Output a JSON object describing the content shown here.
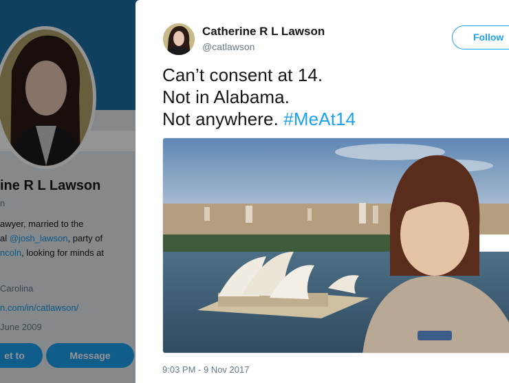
{
  "profile_background": {
    "name_fragment": "ine R L Lawson",
    "handle_fragment": "n",
    "bio_lines": [
      {
        "pre": "awyer, married to the",
        "link": ""
      },
      {
        "pre": "al ",
        "link": "@josh_lawson",
        "post": ", party of"
      },
      {
        "pre": "",
        "link": "ncoln",
        "post": ", looking for minds at"
      }
    ],
    "location_fragment": "Carolina",
    "url_fragment": "n.com/in/catlawson/",
    "joined_fragment": "June 2009",
    "follow_button_fragment": "et to",
    "message_button": "Message"
  },
  "tweet": {
    "author_name": "Catherine R L Lawson",
    "author_handle": "@catlawson",
    "follow_label": "Follow",
    "text_lines": [
      "Can’t consent at 14.",
      "Not in Alabama.",
      "Not anywhere. "
    ],
    "hashtag": "#MeAt14",
    "timestamp": "9:03 PM - 9 Nov 2017"
  },
  "colors": {
    "accent": "#1da1f2",
    "banner": "#1d6ea5",
    "text": "#14171a",
    "muted": "#657786"
  }
}
